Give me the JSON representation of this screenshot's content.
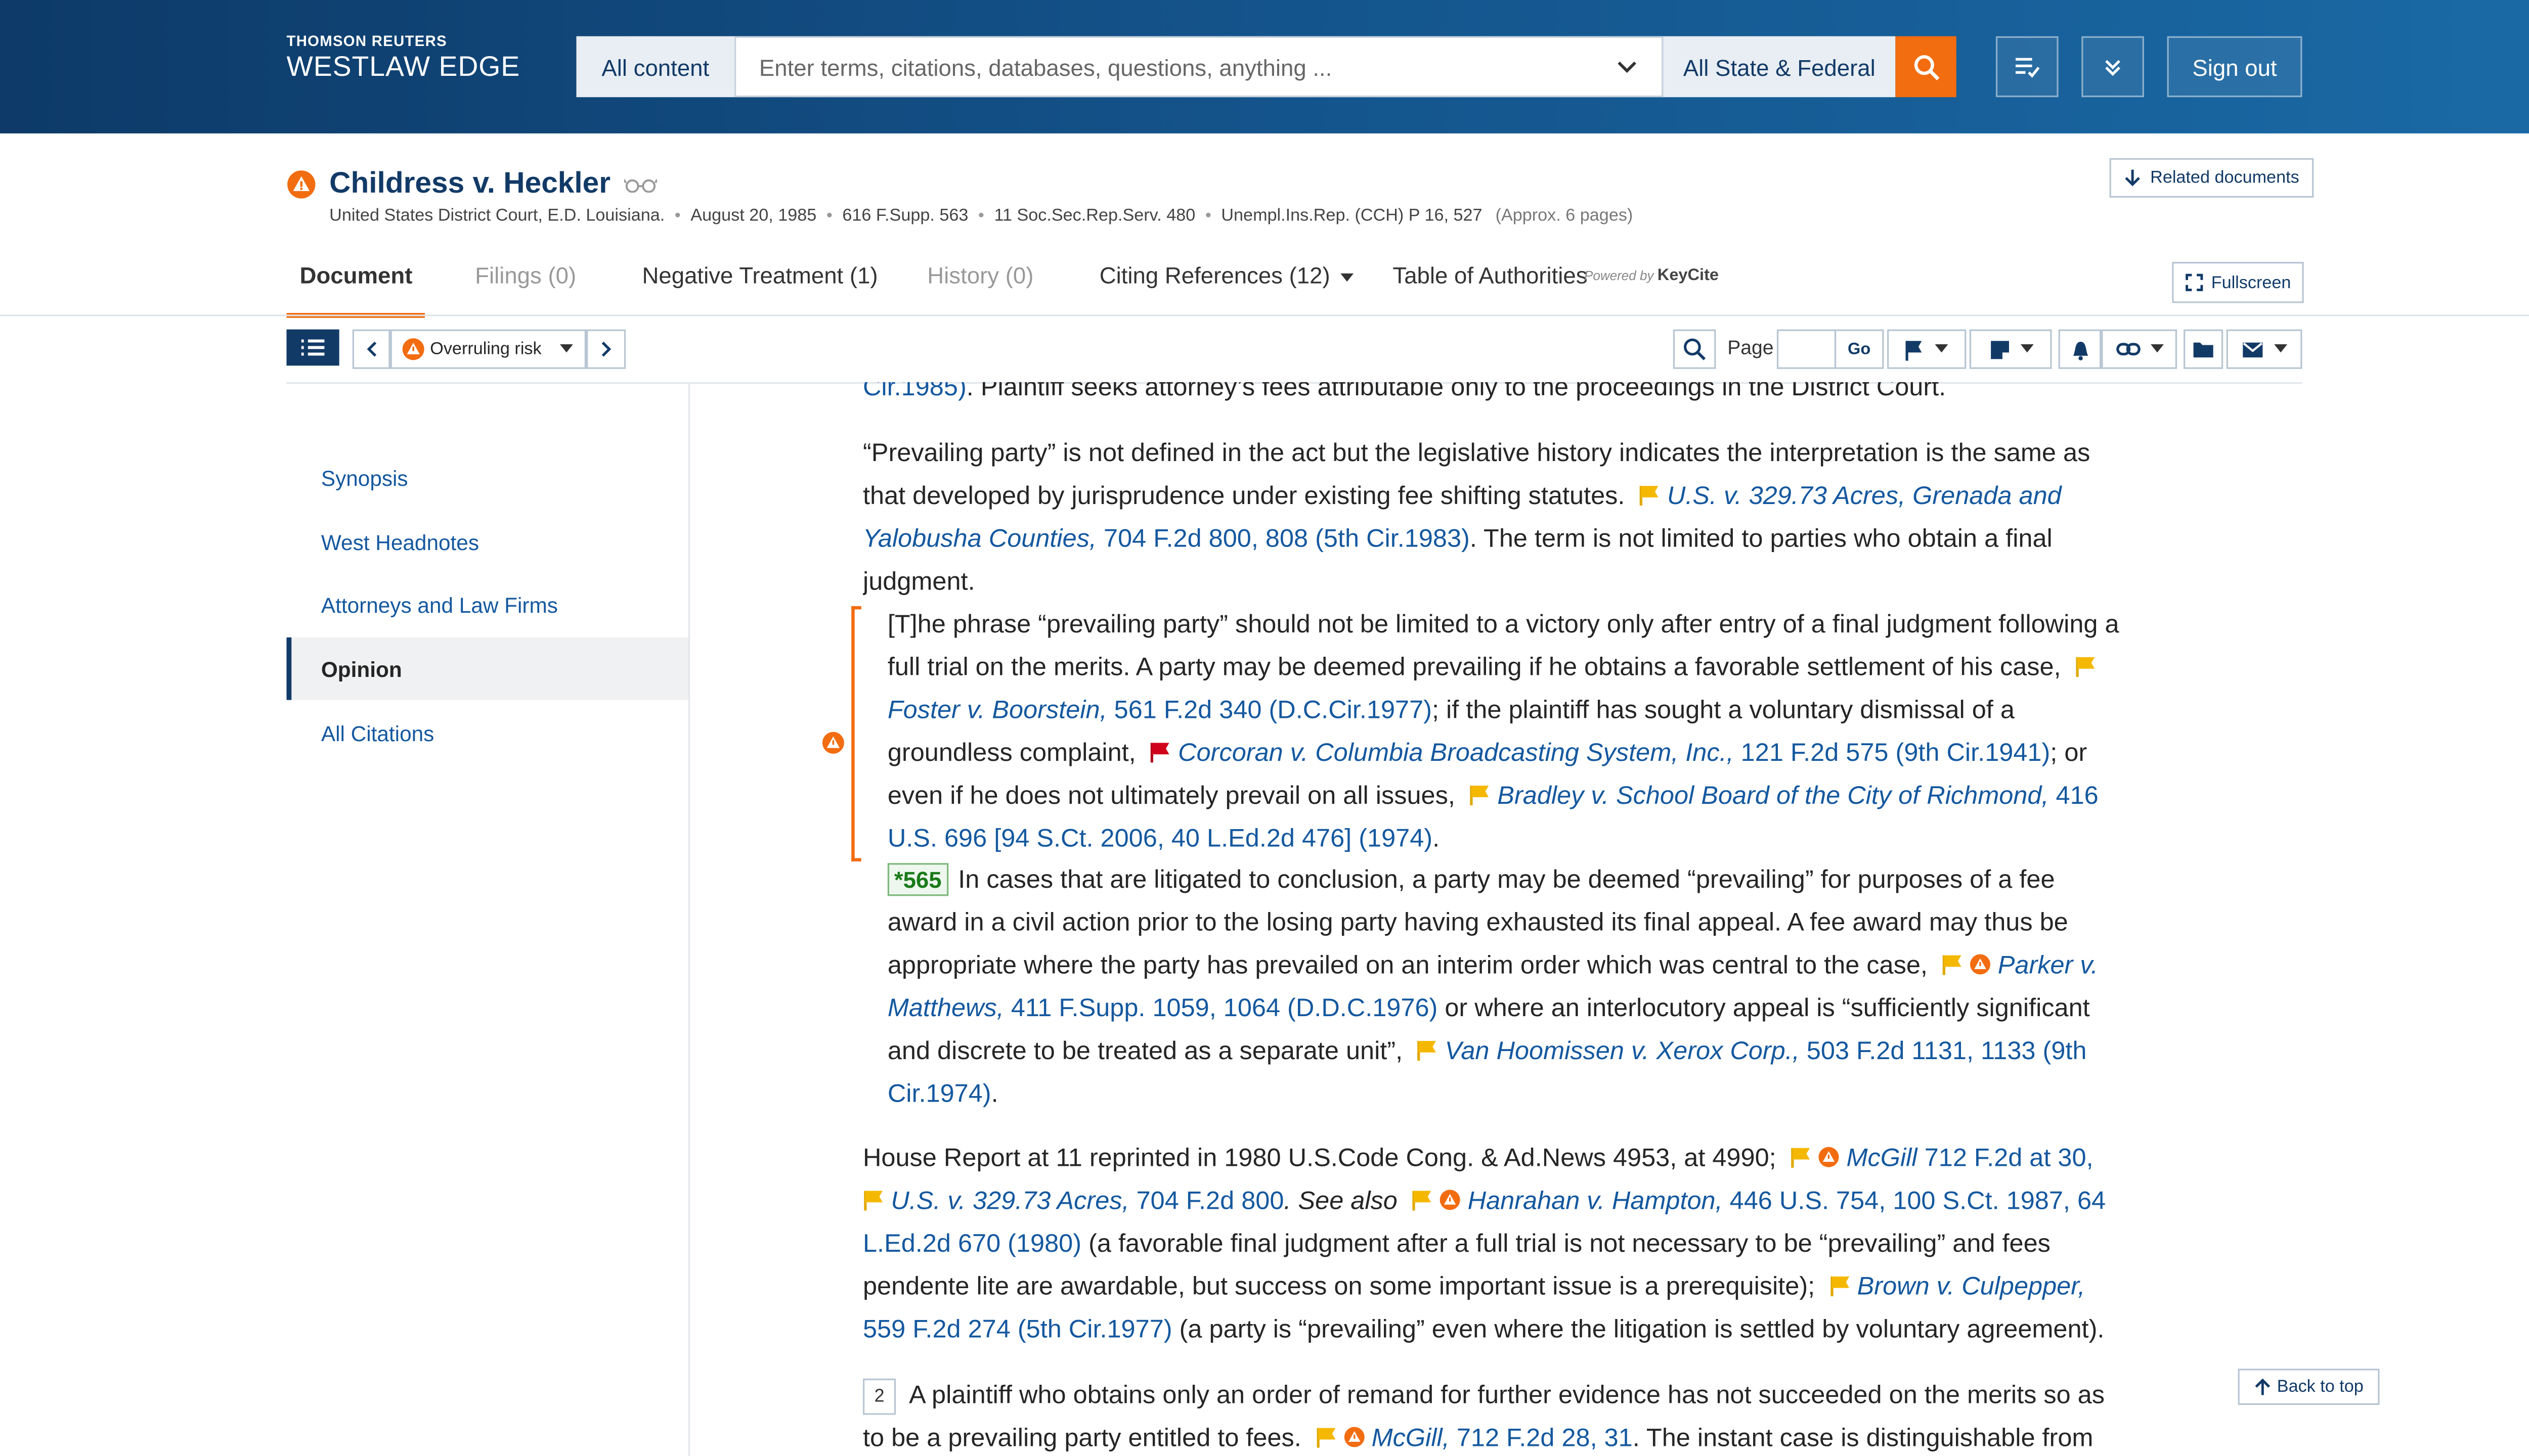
{
  "header": {
    "brand_top": "THOMSON REUTERS",
    "brand_main": "WESTLAW EDGE",
    "scope_label": "All content",
    "search_placeholder": "Enter terms, citations, databases, questions, anything ...",
    "jurisdiction_label": "All State & Federal",
    "sign_out_label": "Sign out",
    "accent": "#f26c10",
    "navy": "#123a67"
  },
  "document": {
    "title": "Childress v. Heckler",
    "court": "United States District Court, E.D. Louisiana.",
    "date": "August 20, 1985",
    "cite1": "616 F.Supp. 563",
    "cite2": "11 Soc.Sec.Rep.Serv. 480",
    "cite3": "Unempl.Ins.Rep. (CCH) P 16, 527",
    "approx_pages": "(Approx. 6 pages)",
    "related_label": "Related documents"
  },
  "tabs": [
    {
      "label": "Document"
    },
    {
      "label": "Filings (0)"
    },
    {
      "label": "Negative Treatment (1)"
    },
    {
      "label": "History (0)"
    },
    {
      "label": "Citing References (12)"
    },
    {
      "label": "Table of Authorities"
    }
  ],
  "keycite": {
    "powered": "Powered by",
    "brand": "KeyCite"
  },
  "fullscreen_label": "Fullscreen",
  "toolbar": {
    "risk_label": "Overruling risk",
    "page_label": "Page",
    "go_label": "Go"
  },
  "sidebar": {
    "items": [
      {
        "label": "Synopsis"
      },
      {
        "label": "West Headnotes"
      },
      {
        "label": "Attorneys and Law Firms"
      },
      {
        "label": "Opinion"
      },
      {
        "label": "All Citations"
      }
    ]
  },
  "content": {
    "p0_link": "Cir.1985)",
    "p0_text": ". Plaintiff seeks attorney’s fees attributable only to the proceedings in the District Court.",
    "p1_text": "“Prevailing party” is not defined in the act but the legislative history indicates the interpretation is the same as that developed by jurisprudence under existing fee shifting statutes.",
    "p1_case": "U.S. v. 329.73 Acres, Grenada and Yalobusha Counties,",
    "p1_cite": "704 F.2d 800, 808 (5th Cir.1983)",
    "p1_tail": ". The term is not limited to parties who obtain a final judgment.",
    "q1_text": "[T]he phrase “prevailing party” should not be limited to a victory only after entry of a final judgment following a full trial on the merits. A party may be deemed prevailing if he obtains a favorable settlement of his case,",
    "q1_case1": "Foster v. Boorstein,",
    "q1_cite1": "561 F.2d 340 (D.C.Cir.1977)",
    "q1_mid1": "; if the plaintiff has sought a voluntary dismissal of a groundless complaint,",
    "q1_case2": "Corcoran v. Columbia Broadcasting System, Inc.,",
    "q1_cite2": "121 F.2d 575 (9th Cir.1941)",
    "q1_mid2": "; or even if he does not ultimately prevail on all issues,",
    "q1_case3": "Bradley v. School Board of the City of Richmond,",
    "q1_cite3": "416 U.S. 696 [94 S.Ct. 2006, 40 L.Ed.2d 476] (1974)",
    "q1_end": ".",
    "star_page": "*565",
    "q2_text": "In cases that are litigated to conclusion, a party may be deemed “prevailing” for purposes of a fee award in a civil action prior to the losing party having exhausted its final appeal. A fee award may thus be appropriate where the party has prevailed on an interim order which was central to the case,",
    "q2_case1": "Parker v. Matthews,",
    "q2_cite1": "411 F.Supp. 1059, 1064 (D.D.C.1976)",
    "q2_mid": " or where an interlocutory appeal is “sufficiently significant and discrete to be treated as a separate unit”,",
    "q2_case2": "Van Hoomissen v. Xerox Corp.,",
    "q2_cite2": "503 F.2d 1131, 1133 (9th Cir.1974)",
    "q2_end": ".",
    "p2_text": "House Report at 11 reprinted in 1980 U.S.Code Cong. & Ad.News 4953, at 4990;",
    "p2_case1": "McGill",
    "p2_cite1": "712 F.2d at 30,",
    "p2_case2": "U.S. v. 329.73 Acres,",
    "p2_cite2": "704 F.2d 800",
    "p2_see": ". See also",
    "p2_case3": "Hanrahan v. Hampton,",
    "p2_cite3": "446 U.S. 754, 100 S.Ct. 1987, 64 L.Ed.2d 670 (1980)",
    "p2_mid": " (a favorable final judgment after a full trial is not necessary to be “prevailing” and fees pendente lite are awardable, but success on some important issue is a prerequisite);",
    "p2_case4": "Brown v. Culpepper,",
    "p2_cite4": "559 F.2d 274 (5th Cir.1977)",
    "p2_end": " (a party is “prevailing” even where the litigation is settled by voluntary agreement).",
    "fn_num": "2",
    "p3_text": "A plaintiff who obtains only an order of remand for further evidence has not succeeded on the merits so as to be a prevailing party entitled to fees.",
    "p3_case": "McGill,",
    "p3_cite": "712 F.2d 28, 31",
    "p3_tail": ". The instant case is distinguishable from"
  },
  "back_to_top_label": "Back to top",
  "flag_colors": {
    "yellow": "#f5b800",
    "red": "#d0021b"
  }
}
